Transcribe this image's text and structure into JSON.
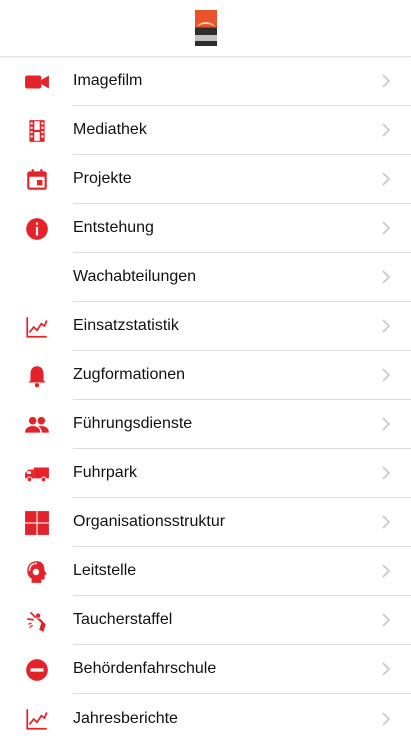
{
  "theme": {
    "accent": "#e4222a",
    "chevron": "#c7c7cc",
    "divider": "#dcdcdc"
  },
  "header": {
    "logo": "fire-department-logo"
  },
  "menu": [
    {
      "label": "Imagefilm",
      "icon": "video-camera-icon"
    },
    {
      "label": "Mediathek",
      "icon": "film-strip-icon"
    },
    {
      "label": "Projekte",
      "icon": "calendar-icon"
    },
    {
      "label": "Entstehung",
      "icon": "info-icon"
    },
    {
      "label": "Wachabteilungen",
      "icon": ""
    },
    {
      "label": "Einsatzstatistik",
      "icon": "line-chart-icon"
    },
    {
      "label": "Zugformationen",
      "icon": "bell-icon"
    },
    {
      "label": "Führungsdienste",
      "icon": "people-icon"
    },
    {
      "label": "Fuhrpark",
      "icon": "truck-icon"
    },
    {
      "label": "Organisationsstruktur",
      "icon": "grid-icon"
    },
    {
      "label": "Leitstelle",
      "icon": "headset-icon"
    },
    {
      "label": "Taucherstaffel",
      "icon": "diver-icon"
    },
    {
      "label": "Behördenfahrschule",
      "icon": "no-entry-icon"
    },
    {
      "label": "Jahresberichte",
      "icon": "line-chart-icon"
    }
  ]
}
